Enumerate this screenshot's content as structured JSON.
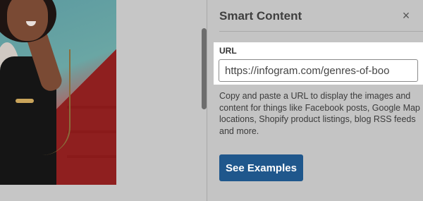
{
  "panel": {
    "title": "Smart Content",
    "close_icon": "close-icon"
  },
  "url_field": {
    "label": "URL",
    "value": "https://infogram.com/genres-of-boo"
  },
  "description": "Copy and paste a URL to display the images and content for things like Facebook posts, Google Map locations, Shopify product listings, blog RSS feeds and more.",
  "examples_button": {
    "label": "See Examples"
  },
  "colors": {
    "overlay_gray": "#c4c4c4",
    "button_blue": "#1f578c",
    "highlight_white": "#ffffff"
  }
}
